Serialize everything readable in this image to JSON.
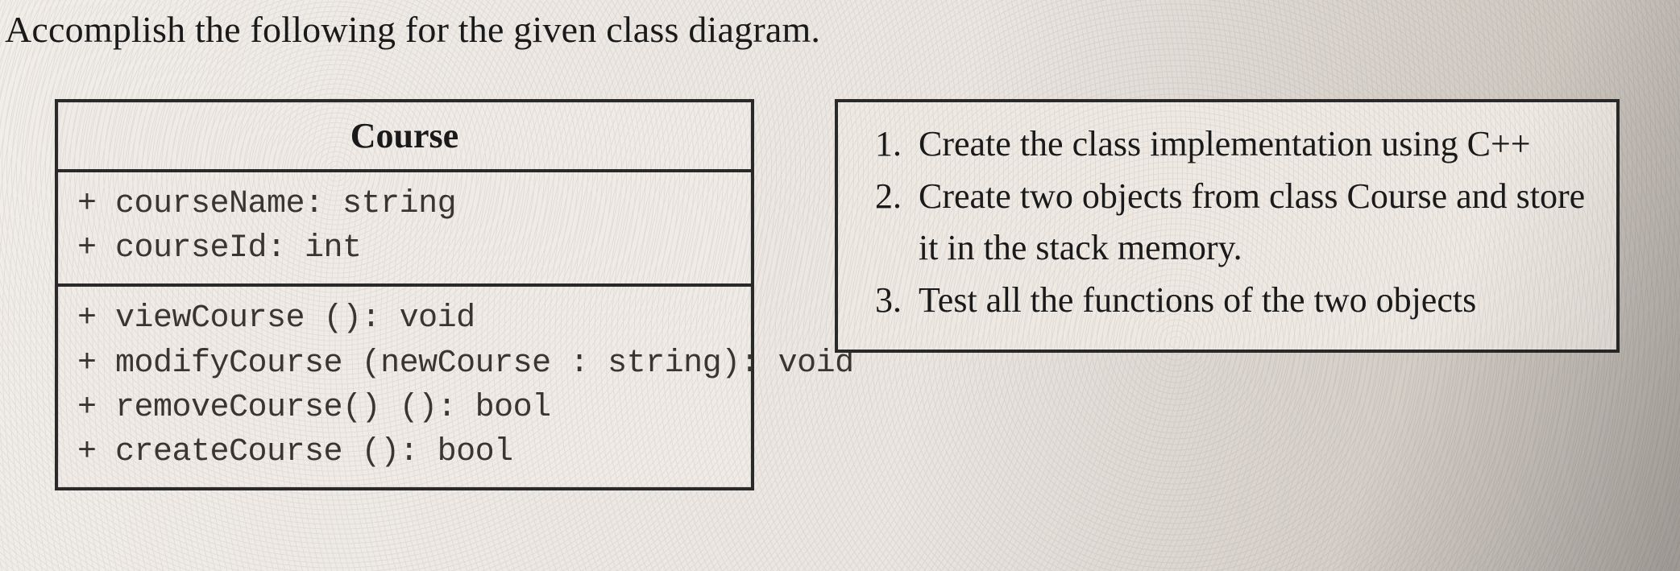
{
  "heading": "Accomplish the following for the given class diagram.",
  "uml": {
    "title": "Course",
    "attributes": [
      "+ courseName: string",
      "+ courseId: int"
    ],
    "methods": [
      "+ viewCourse (): void",
      "+ modifyCourse (newCourse : string): void",
      "+ removeCourse() (): bool",
      "+ createCourse (): bool"
    ]
  },
  "tasks": [
    "Create the class implementation using C++",
    "Create two objects from class Course and store it in the stack memory.",
    "Test all the functions of the two objects"
  ]
}
